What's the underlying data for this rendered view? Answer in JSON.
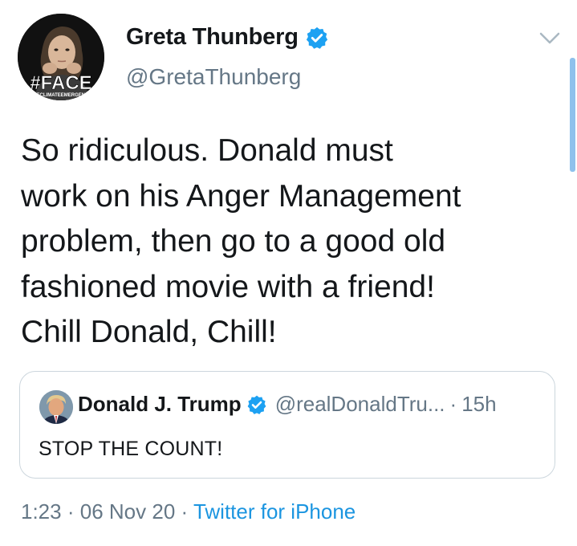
{
  "author": {
    "display_name": "Greta Thunberg",
    "handle": "@GretaThunberg",
    "verified": true,
    "avatar": {
      "overlay_text": "#FACE",
      "overlay_subtext": "THECLIMATEEMERGENCY"
    }
  },
  "tweet": {
    "text": "So ridiculous. Donald must\nwork on his Anger Management\nproblem, then go to a good old\nfashioned movie with a friend!\nChill Donald, Chill!"
  },
  "quoted_tweet": {
    "display_name": "Donald J. Trump",
    "verified": true,
    "handle": "@realDonaldTru...",
    "separator": "·",
    "time": "15h",
    "text": "STOP THE COUNT!"
  },
  "meta": {
    "time": "1:23",
    "separator_1": "·",
    "date": "06 Nov 20",
    "separator_2": "·",
    "source": "Twitter for iPhone"
  },
  "icons": {
    "verified": "verified-badge-icon",
    "menu": "chevron-down-icon"
  },
  "colors": {
    "text_primary": "#14171a",
    "text_secondary": "#657786",
    "link": "#1b95e0",
    "verified": "#1da1f2",
    "border": "#ccd6dd",
    "scrollbar": "#8ec1ec"
  }
}
